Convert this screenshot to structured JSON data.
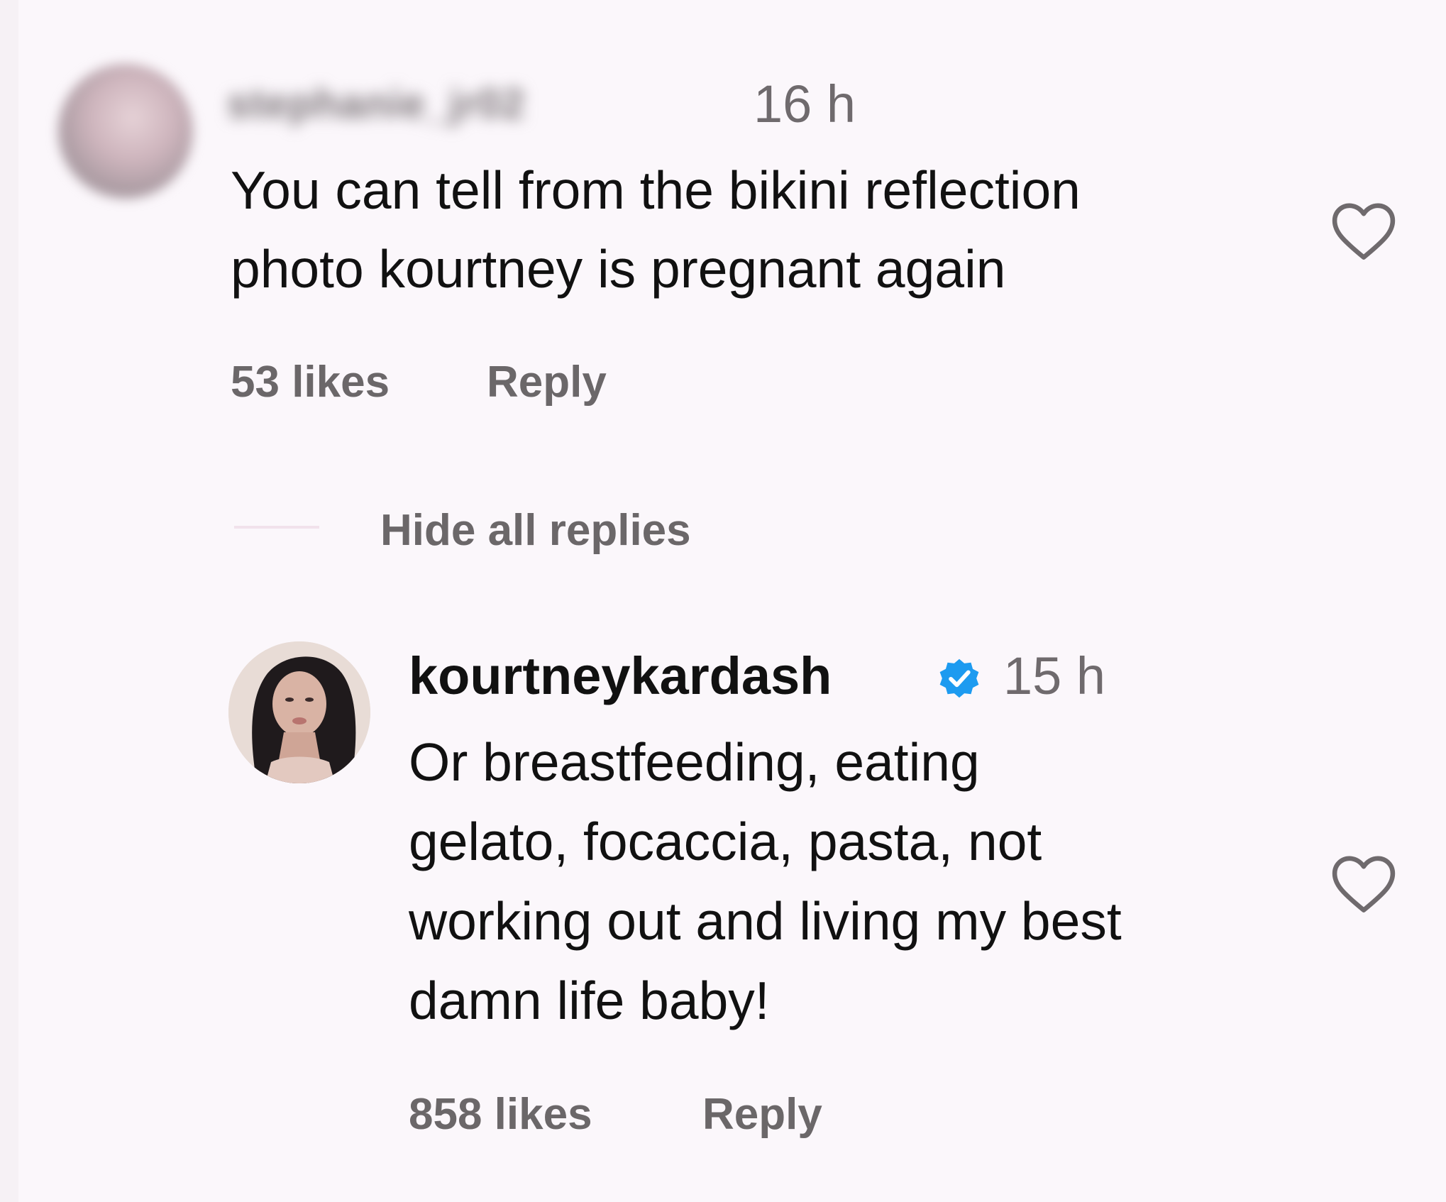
{
  "comments": [
    {
      "username": "stephanie_jr02",
      "username_blurred": true,
      "time": "16 h",
      "text": "You can tell from the bikini reflection\nphoto kourtney is pregnant again",
      "likes": "53 likes",
      "reply_label": "Reply",
      "avatar_icon": "user-avatar-blurred",
      "like_icon": "heart-outline-icon"
    }
  ],
  "replies_toggle": {
    "label": "Hide all replies"
  },
  "replies": [
    {
      "username": "kourtneykardash",
      "verified": true,
      "verified_icon": "verified-badge-icon",
      "verified_color": "#1d9bf0",
      "time": "15 h",
      "text": "Or breastfeeding, eating\ngelato, focaccia, pasta, not\nworking out and living my best\ndamn life baby!",
      "likes": "858 likes",
      "reply_label": "Reply",
      "avatar_icon": "user-avatar-photo",
      "like_icon": "heart-outline-icon"
    }
  ],
  "colors": {
    "background": "#fbf7fb",
    "text_primary": "#111111",
    "text_secondary": "#6b6769"
  }
}
